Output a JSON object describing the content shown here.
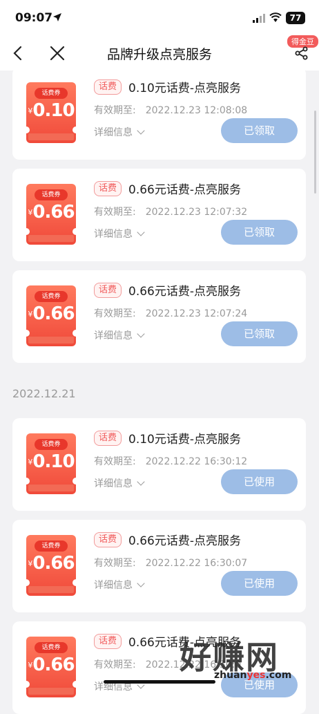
{
  "status_bar": {
    "time": "09:07",
    "battery": "77"
  },
  "nav": {
    "title": "品牌升级点亮服务",
    "badge": "得金豆"
  },
  "section_date": "2022.12.21",
  "coupon_tag": "话费券",
  "currency": "¥",
  "pill_label": "话费",
  "valid_label": "有效期至:",
  "detail_label": "详细信息",
  "cards": [
    {
      "amount": "0.10",
      "title": "0.10元话费-点亮服务",
      "valid_until": "2022.12.23 12:08:08",
      "button": "已领取"
    },
    {
      "amount": "0.66",
      "title": "0.66元话费-点亮服务",
      "valid_until": "2022.12.23 12:07:32",
      "button": "已领取"
    },
    {
      "amount": "0.66",
      "title": "0.66元话费-点亮服务",
      "valid_until": "2022.12.23 12:07:24",
      "button": "已领取"
    },
    {
      "amount": "0.10",
      "title": "0.10元话费-点亮服务",
      "valid_until": "2022.12.22 16:30:12",
      "button": "已使用"
    },
    {
      "amount": "0.66",
      "title": "0.66元话费-点亮服务",
      "valid_until": "2022.12.22 16:30:07",
      "button": "已使用"
    },
    {
      "amount": "0.66",
      "title": "0.66元话费-点亮服务",
      "valid_until": "2022.12.22 16:30:0",
      "button": "已使用"
    }
  ],
  "watermark": {
    "big": "好赚网",
    "small_a": "zhuan",
    "small_b": "yes",
    "small_c": ".com"
  },
  "colors": {
    "accent_red": "#f04a3a",
    "button_blue": "#9dbde6"
  }
}
